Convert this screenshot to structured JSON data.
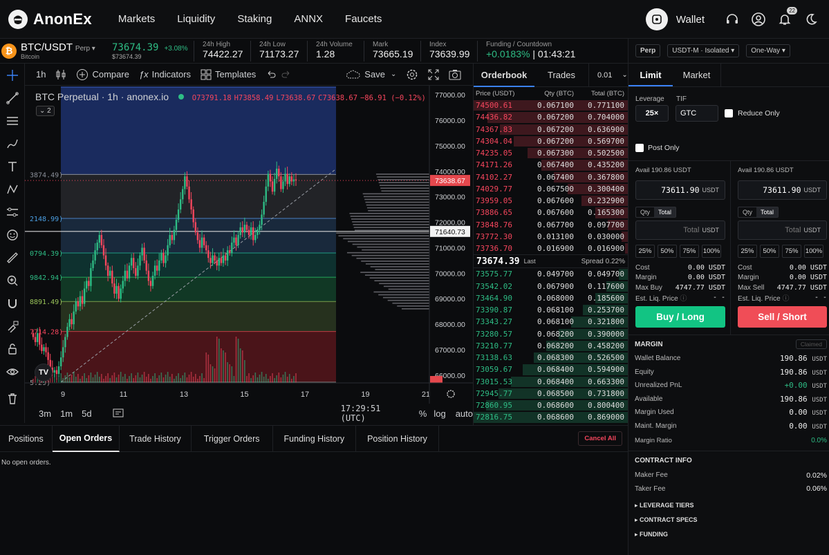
{
  "brand": {
    "name": "AnonEx"
  },
  "nav": {
    "links": [
      "Markets",
      "Liquidity",
      "Staking",
      "ANNX",
      "Faucets"
    ],
    "wallet": "Wallet",
    "notifications": "22"
  },
  "ticker": {
    "coin_glyph": "₿",
    "symbol": "BTC/USDT",
    "type": "Perp ▾",
    "name": "Bitcoin",
    "price": "73674.39",
    "change": "+3.08%",
    "price_sub": "$73674.39",
    "stats": [
      {
        "label": "24h High",
        "value": "74422.27"
      },
      {
        "label": "24h Low",
        "value": "71173.27"
      },
      {
        "label": "24h Volume",
        "value": "1.28"
      },
      {
        "label": "Mark",
        "value": "73665.19"
      },
      {
        "label": "Index",
        "value": "73639.99"
      }
    ],
    "funding_label": "Funding / Countdown",
    "funding_rate": "+0.0183%",
    "countdown": "| 01:43:21"
  },
  "chart_toolbar": {
    "interval": "1h",
    "compare": "Compare",
    "indicators": "Indicators",
    "templates": "Templates",
    "save": "Save"
  },
  "chart": {
    "title": "BTC Perpetual · 1h · anonex.io",
    "ohlc": {
      "o": "O73791.18",
      "h": "H73858.49",
      "l": "L73638.67",
      "c": "C73638.67",
      "chg": "−86.91 (−0.12%)"
    },
    "collapse_label": "⌄ 2",
    "last_price_tag": "73638.67",
    "cross_price_tag": "71640.73",
    "bottom_red_tag": "",
    "fib_labels": [
      "3874.49)",
      "2148.99)",
      "0794.39)",
      "9842.94)",
      "8891.49)",
      "7714.28)",
      "5.29)"
    ],
    "time": "17:29:51 (UTC)",
    "ranges": [
      "3m",
      "1m",
      "5d"
    ],
    "scale": [
      "%",
      "log",
      "auto"
    ],
    "watermark": "TV"
  },
  "chart_data": {
    "type": "candlestick",
    "y_ticks": [
      77000,
      76000,
      75000,
      74000,
      73000,
      72000,
      71000,
      70000,
      69000,
      68000,
      67000,
      66000
    ],
    "y_tick_labels": [
      "77000.00",
      "76000.00",
      "75000.00",
      "74000.00",
      "73000.00",
      "72000.00",
      "71000.00",
      "70000.00",
      "69000.00",
      "68000.00",
      "67000.00",
      "66000.00"
    ],
    "x_tick_labels": [
      "9",
      "11",
      "13",
      "15",
      "17",
      "19",
      "21"
    ],
    "ylim": [
      65700,
      77300
    ],
    "fib_levels": [
      73874.49,
      72148.99,
      70794.39,
      69842.94,
      68891.49,
      67714.28
    ],
    "fib_top": 77300,
    "fib_bottom": 65729.29,
    "last_price": 73638.67,
    "cross_price": 71640.73,
    "closes": [
      67500,
      67300,
      67650,
      67200,
      66950,
      67100,
      66900,
      66600,
      66300,
      66100,
      66200,
      66050,
      66350,
      66700,
      67100,
      67500,
      67900,
      68200,
      68000,
      68500,
      68900,
      68700,
      69100,
      68800,
      69400,
      69700,
      69500,
      70200,
      70500,
      70900,
      71200,
      71500,
      71100,
      70700,
      70300,
      69900,
      70100,
      69600,
      69200,
      69500,
      69000,
      69400,
      69700,
      70100,
      69800,
      70300,
      70600,
      70200,
      69900,
      70300,
      70700,
      71000,
      70500,
      70100,
      69700,
      69500,
      69900,
      70300,
      70100,
      70500,
      70800,
      70400,
      70700,
      71100,
      71500,
      71300,
      71700,
      72100,
      72500,
      72900,
      73300,
      73800,
      73400,
      72900,
      72500,
      72000,
      71600,
      71300,
      71000,
      71400,
      71100,
      70900,
      70600,
      70400,
      70700,
      70500,
      70300,
      70600,
      70400,
      70700,
      70500,
      70900,
      70800,
      71200,
      71400,
      71100,
      71500,
      71800,
      71600,
      71900,
      71700,
      71500,
      71800,
      71300,
      71500,
      71700,
      71900,
      72300,
      72800,
      73400,
      73900,
      73600,
      73200,
      73700,
      74100,
      73800,
      73300,
      73600,
      73900,
      73500,
      73800,
      73600,
      73680,
      73640
    ]
  },
  "orderbook": {
    "tabs": [
      "Orderbook",
      "Trades",
      "0.01"
    ],
    "headers": [
      "Price (USDT)",
      "Qty (BTC)",
      "Total (BTC)"
    ],
    "asks": [
      [
        "74500.61",
        "0.067100",
        "0.771100"
      ],
      [
        "74436.82",
        "0.067200",
        "0.704000"
      ],
      [
        "74367.83",
        "0.067200",
        "0.636900"
      ],
      [
        "74304.04",
        "0.067200",
        "0.569700"
      ],
      [
        "74235.05",
        "0.067300",
        "0.502500"
      ],
      [
        "74171.26",
        "0.067400",
        "0.435200"
      ],
      [
        "74102.27",
        "0.067400",
        "0.367800"
      ],
      [
        "74029.77",
        "0.067500",
        "0.300400"
      ],
      [
        "73959.05",
        "0.067600",
        "0.232900"
      ],
      [
        "73886.65",
        "0.067600",
        "0.165300"
      ],
      [
        "73848.76",
        "0.067700",
        "0.097700"
      ],
      [
        "73772.30",
        "0.013100",
        "0.030000"
      ],
      [
        "73736.70",
        "0.016900",
        "0.016900"
      ]
    ],
    "ask_fill": [
      1.0,
      0.91,
      0.83,
      0.74,
      0.65,
      0.56,
      0.48,
      0.39,
      0.3,
      0.21,
      0.13,
      0.04,
      0.02
    ],
    "last": "73674.39",
    "last_label": "Last",
    "spread": "Spread 0.22%",
    "bids": [
      [
        "73575.77",
        "0.049700",
        "0.049700"
      ],
      [
        "73542.02",
        "0.067900",
        "0.117600"
      ],
      [
        "73464.90",
        "0.068000",
        "0.185600"
      ],
      [
        "73390.87",
        "0.068100",
        "0.253700"
      ],
      [
        "73343.27",
        "0.068100",
        "0.321800"
      ],
      [
        "73280.57",
        "0.068200",
        "0.390000"
      ],
      [
        "73210.77",
        "0.068200",
        "0.458200"
      ],
      [
        "73138.63",
        "0.068300",
        "0.526500"
      ],
      [
        "73059.67",
        "0.068400",
        "0.594900"
      ],
      [
        "73015.53",
        "0.068400",
        "0.663300"
      ],
      [
        "72945.77",
        "0.068500",
        "0.731800"
      ],
      [
        "72860.95",
        "0.068600",
        "0.800400"
      ],
      [
        "72816.75",
        "0.068600",
        "0.869000"
      ]
    ],
    "bid_fill": [
      0.06,
      0.14,
      0.21,
      0.29,
      0.37,
      0.45,
      0.53,
      0.61,
      0.68,
      0.76,
      0.84,
      0.92,
      1.0
    ]
  },
  "trade": {
    "perp": "Perp",
    "margin_mode": "USDT-M · Isolated ▾",
    "position_mode": "One-Way ▾",
    "tabs": [
      "Limit",
      "Market"
    ],
    "leverage_label": "Leverage",
    "leverage": "25×",
    "tif_label": "TIF",
    "tif": "GTC",
    "reduce_only": "Reduce Only",
    "post_only": "Post Only",
    "buy": {
      "avail": "Avail 190.86 USDT",
      "price": "73611.90",
      "unit": "USDT",
      "qty": "Qty",
      "total": "Total",
      "total_placeholder": "Total",
      "pcts": [
        "25%",
        "50%",
        "75%",
        "100%"
      ],
      "rows": [
        [
          "Cost",
          "0.00 USDT"
        ],
        [
          "Margin",
          "0.00 USDT"
        ],
        [
          "Max Buy",
          "4747.77 USDT"
        ],
        [
          "Est. Liq. Price",
          "- -"
        ]
      ],
      "button": "Buy / Long"
    },
    "sell": {
      "avail": "Avail 190.86 USDT",
      "price": "73611.90",
      "unit": "USDT",
      "qty": "Qty",
      "total": "Total",
      "total_placeholder": "Total",
      "pcts": [
        "25%",
        "50%",
        "75%",
        "100%"
      ],
      "rows": [
        [
          "Cost",
          "0.00 USDT"
        ],
        [
          "Margin",
          "0.00 USDT"
        ],
        [
          "Max Sell",
          "4747.77 USDT"
        ],
        [
          "Est. Liq. Price",
          "- -"
        ]
      ],
      "button": "Sell / Short"
    },
    "margin": {
      "title": "MARGIN",
      "claimed": "Claimed",
      "rows": [
        [
          "Wallet Balance",
          "190.86",
          "USDT"
        ],
        [
          "Equity",
          "190.86",
          "USDT"
        ],
        [
          "Unrealized PnL",
          "+0.00",
          "USDT"
        ],
        [
          "Available",
          "190.86",
          "USDT"
        ],
        [
          "Margin Used",
          "0.00",
          "USDT"
        ],
        [
          "Maint. Margin",
          "0.00",
          "USDT"
        ]
      ],
      "ratio_label": "Margin Ratio",
      "ratio": "0.0%"
    },
    "contract": {
      "title": "CONTRACT INFO",
      "maker_label": "Maker Fee",
      "maker": "0.02%",
      "taker_label": "Taker Fee",
      "taker": "0.06%",
      "sections": [
        "▸ LEVERAGE TIERS",
        "▸ CONTRACT SPECS",
        "▸ FUNDING"
      ]
    }
  },
  "orders": {
    "tabs": [
      "Positions",
      "Open Orders",
      "Trade History",
      "Trigger Orders",
      "Funding History",
      "Position History"
    ],
    "cancel_all": "Cancel All",
    "empty": "No open orders."
  },
  "colors": {
    "green": "#2ebd85",
    "red": "#f6465d",
    "bg": "#0b0c0e"
  }
}
